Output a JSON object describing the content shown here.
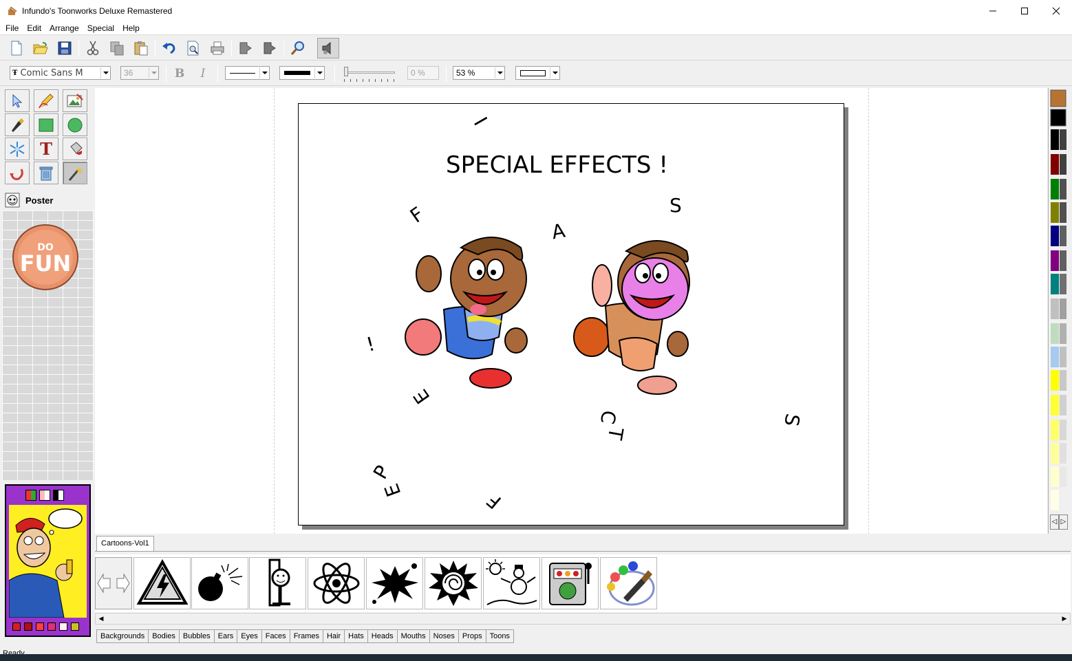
{
  "window": {
    "title": "Infundo's Toonworks Deluxe Remastered"
  },
  "menu": [
    "File",
    "Edit",
    "Arrange",
    "Special",
    "Help"
  ],
  "format_bar": {
    "font": "Comic Sans M",
    "font_size": "36",
    "transparency": "0 %",
    "zoom": "53 %"
  },
  "mode": {
    "label": "Poster"
  },
  "canvas": {
    "headline": "SPECIAL EFFECTS !",
    "scattered_letters": [
      "I",
      "S",
      "F",
      "A",
      "!",
      "E",
      "C",
      "T",
      "S",
      "P",
      "E",
      "F"
    ]
  },
  "palette_colors": [
    "#b87333",
    "#000000",
    "#000000",
    "#800000",
    "#008000",
    "#808000",
    "#000080",
    "#800080",
    "#008080",
    "#c0c0c0",
    "#c0dcc0",
    "#a6caf0",
    "#ffff00",
    "#ffff33",
    "#ffff66",
    "#ffff99",
    "#ffffcc"
  ],
  "library": {
    "tab": "Cartoons-Vol1",
    "thumbs": [
      "warning-lightning",
      "bomb",
      "stick-figure-frame",
      "atom",
      "splat",
      "starburst-spiral",
      "sun-snowman",
      "slot-machine",
      "paint-palette-brush"
    ]
  },
  "categories": [
    "Backgrounds",
    "Bodies",
    "Bubbles",
    "Ears",
    "Eyes",
    "Faces",
    "Frames",
    "Hair",
    "Hats",
    "Heads",
    "Mouths",
    "Noses",
    "Props",
    "Toons"
  ],
  "status": {
    "text": "Ready"
  }
}
